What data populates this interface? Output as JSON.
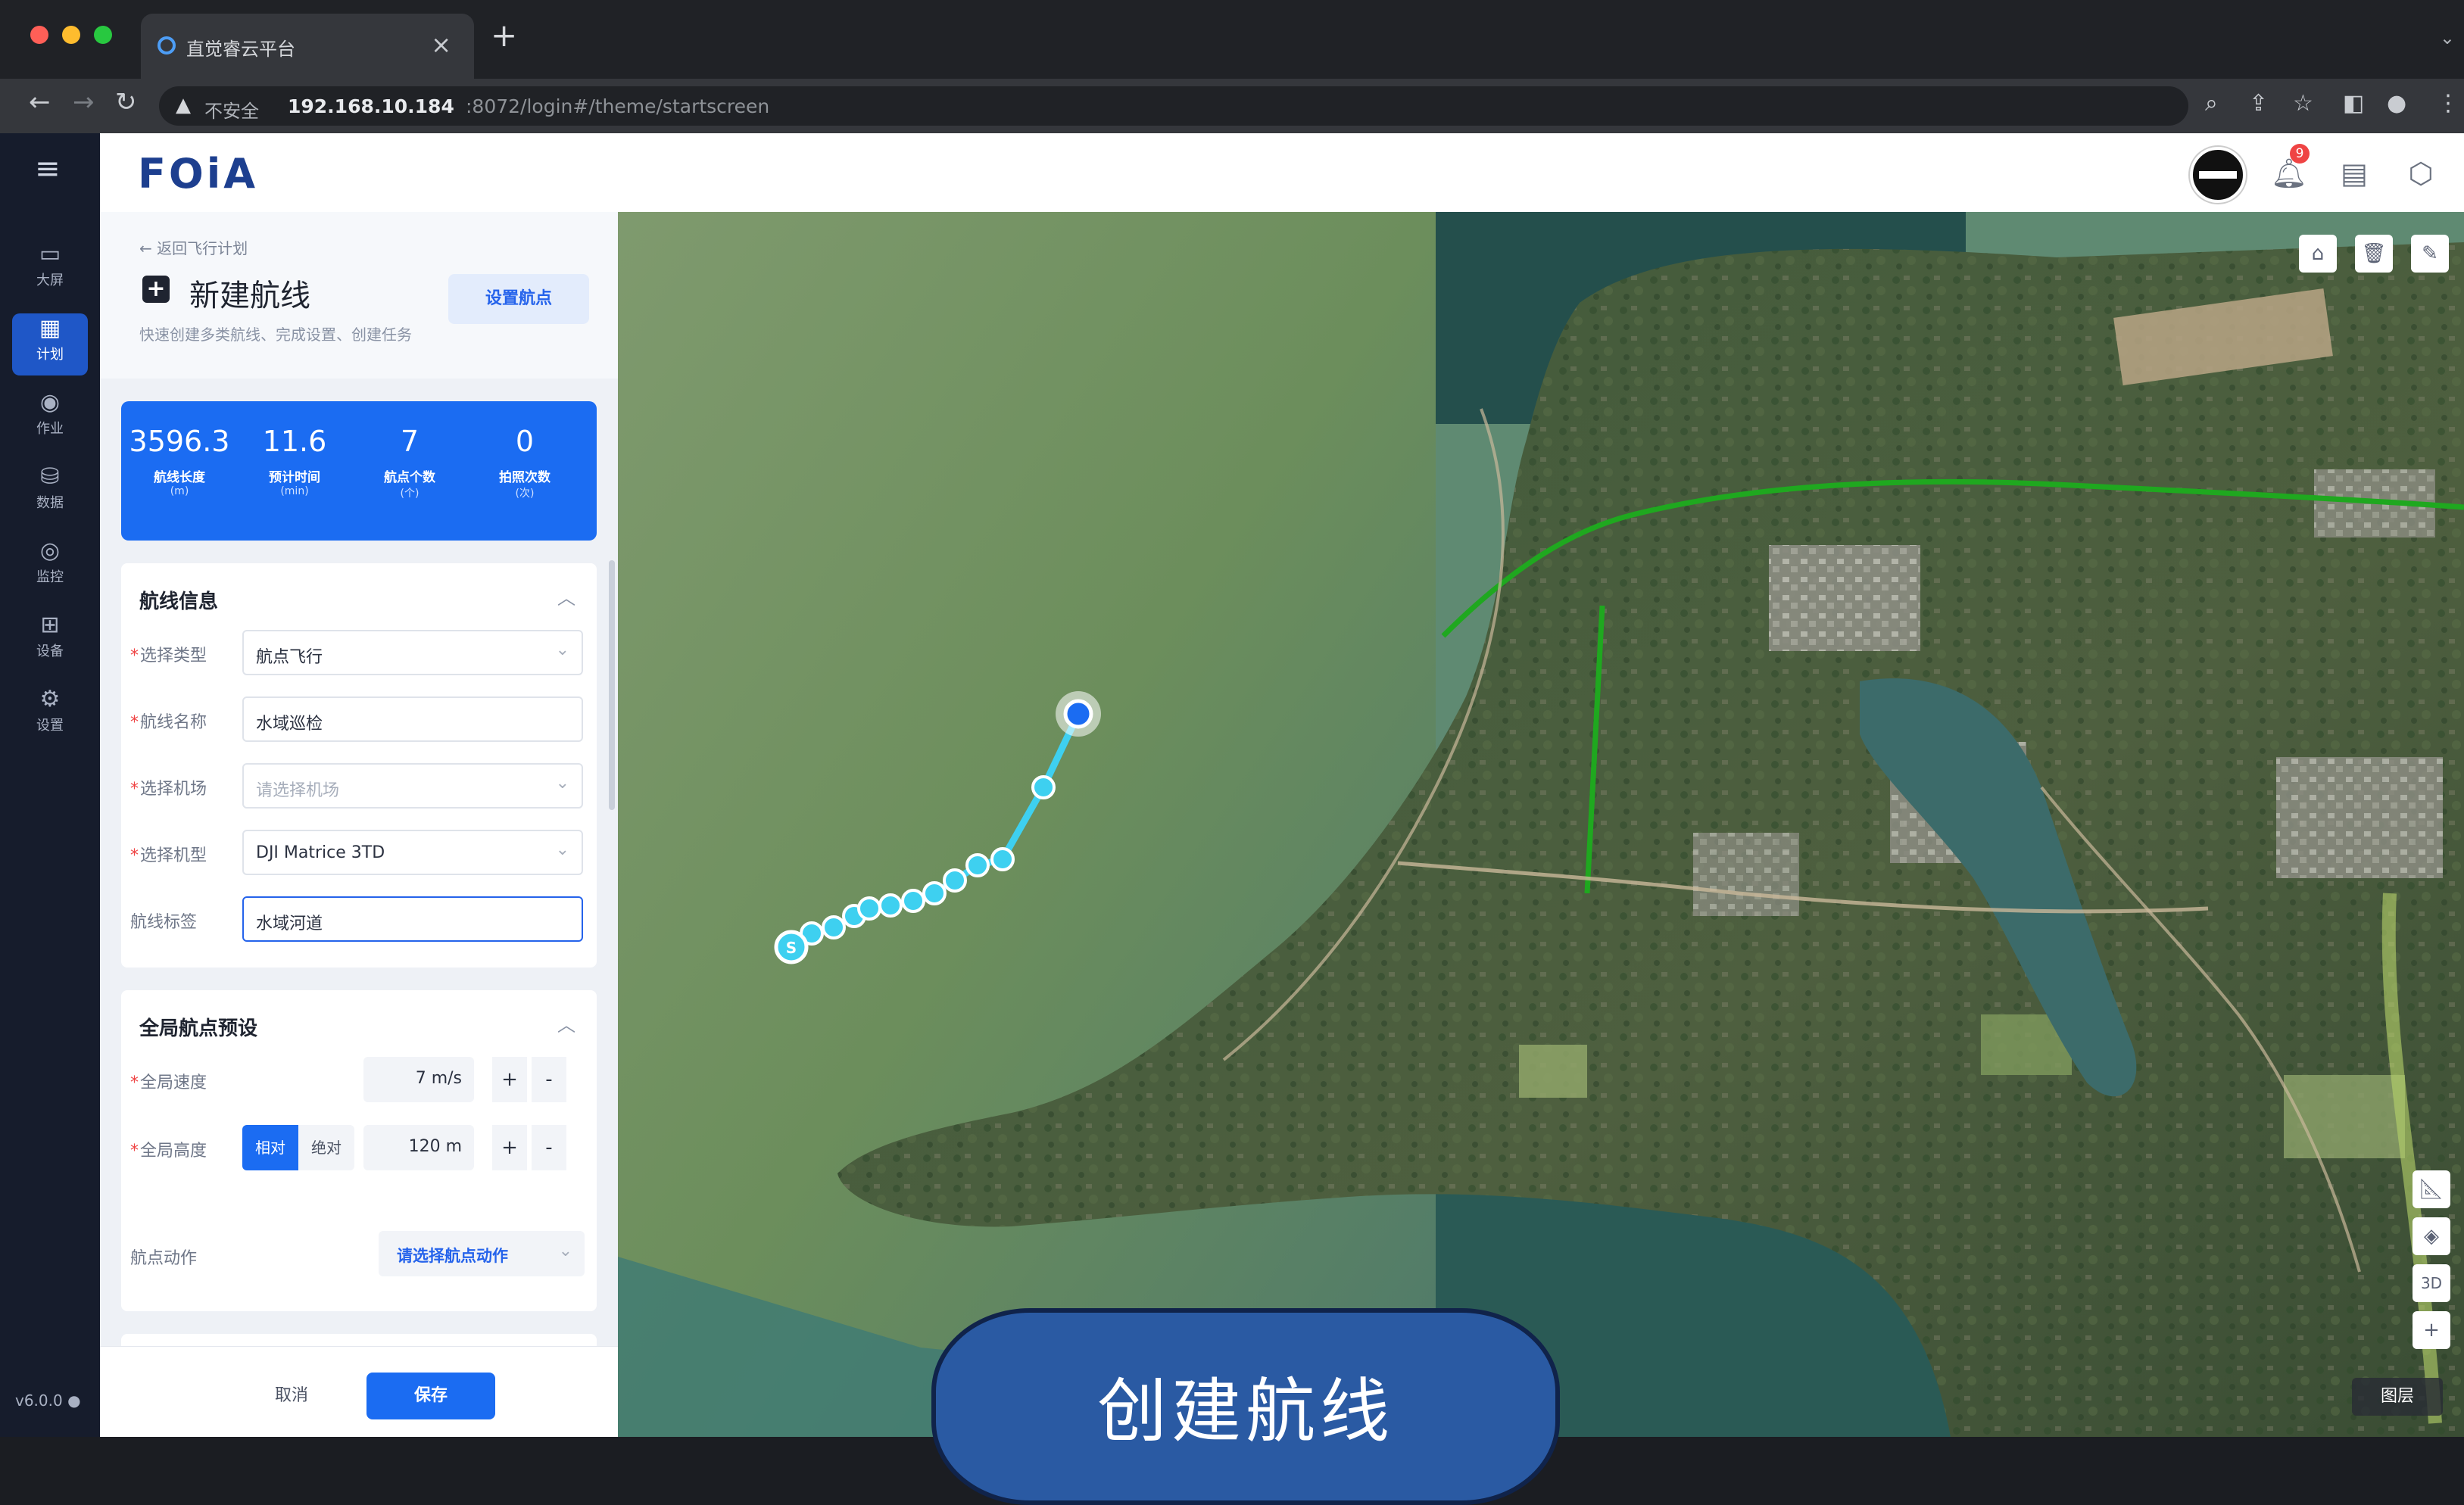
{
  "browser": {
    "tab_title": "直觉睿云平台",
    "insecure_label": "不安全",
    "url_host": "192.168.10.184",
    "url_rest": ":8072/login#/theme/startscreen"
  },
  "nav": {
    "items": [
      {
        "label": "大屏",
        "icon": "screen-icon"
      },
      {
        "label": "计划",
        "icon": "plan-icon"
      },
      {
        "label": "作业",
        "icon": "task-icon"
      },
      {
        "label": "数据",
        "icon": "data-icon"
      },
      {
        "label": "监控",
        "icon": "monitor-icon"
      },
      {
        "label": "设备",
        "icon": "device-icon"
      },
      {
        "label": "设置",
        "icon": "settings-icon"
      }
    ],
    "version": "v6.0.0"
  },
  "header": {
    "logo": "FOiA",
    "bell_badge": "9"
  },
  "panel": {
    "back_label": "返回飞行计划",
    "title": "新建航线",
    "subtitle": "快速创建多类航线、完成设置、创建任务",
    "set_waypoint_label": "设置航点",
    "stats": [
      {
        "value": "3596.3",
        "label": "航线长度",
        "unit": "(m)"
      },
      {
        "value": "11.6",
        "label": "预计时间",
        "unit": "(min)"
      },
      {
        "value": "7",
        "label": "航点个数",
        "unit": "(个)"
      },
      {
        "value": "0",
        "label": "拍照次数",
        "unit": "(次)"
      }
    ],
    "route_info": {
      "title": "航线信息",
      "fields": [
        {
          "label": "选择类型",
          "value": "航点飞行",
          "required": true
        },
        {
          "label": "航线名称",
          "value": "水域巡检",
          "required": true
        },
        {
          "label": "选择机场",
          "value": "请选择机场",
          "required": true
        },
        {
          "label": "选择机型",
          "value": "DJI Matrice 3TD",
          "required": true
        },
        {
          "label": "航线标签",
          "value": "水域河道",
          "required": false
        }
      ]
    },
    "global_preset": {
      "title": "全局航点预设",
      "speed_label": "全局速度",
      "speed_value": "7 m/s",
      "height_label": "全局高度",
      "height_mode_a": "相对",
      "height_mode_b": "绝对",
      "height_value": "120  m",
      "action_label": "航点动作",
      "action_value": "请选择航点动作"
    },
    "cancel_label": "取消",
    "save_label": "保存"
  },
  "map": {
    "legend_label": "图层",
    "btn_3d": "3D",
    "waypoint_start_label": "S"
  },
  "caption": "创建航线",
  "colors": {
    "accent": "#1b6cf2",
    "route": "#3ed0f0",
    "nav_bg": "#161c2c"
  }
}
